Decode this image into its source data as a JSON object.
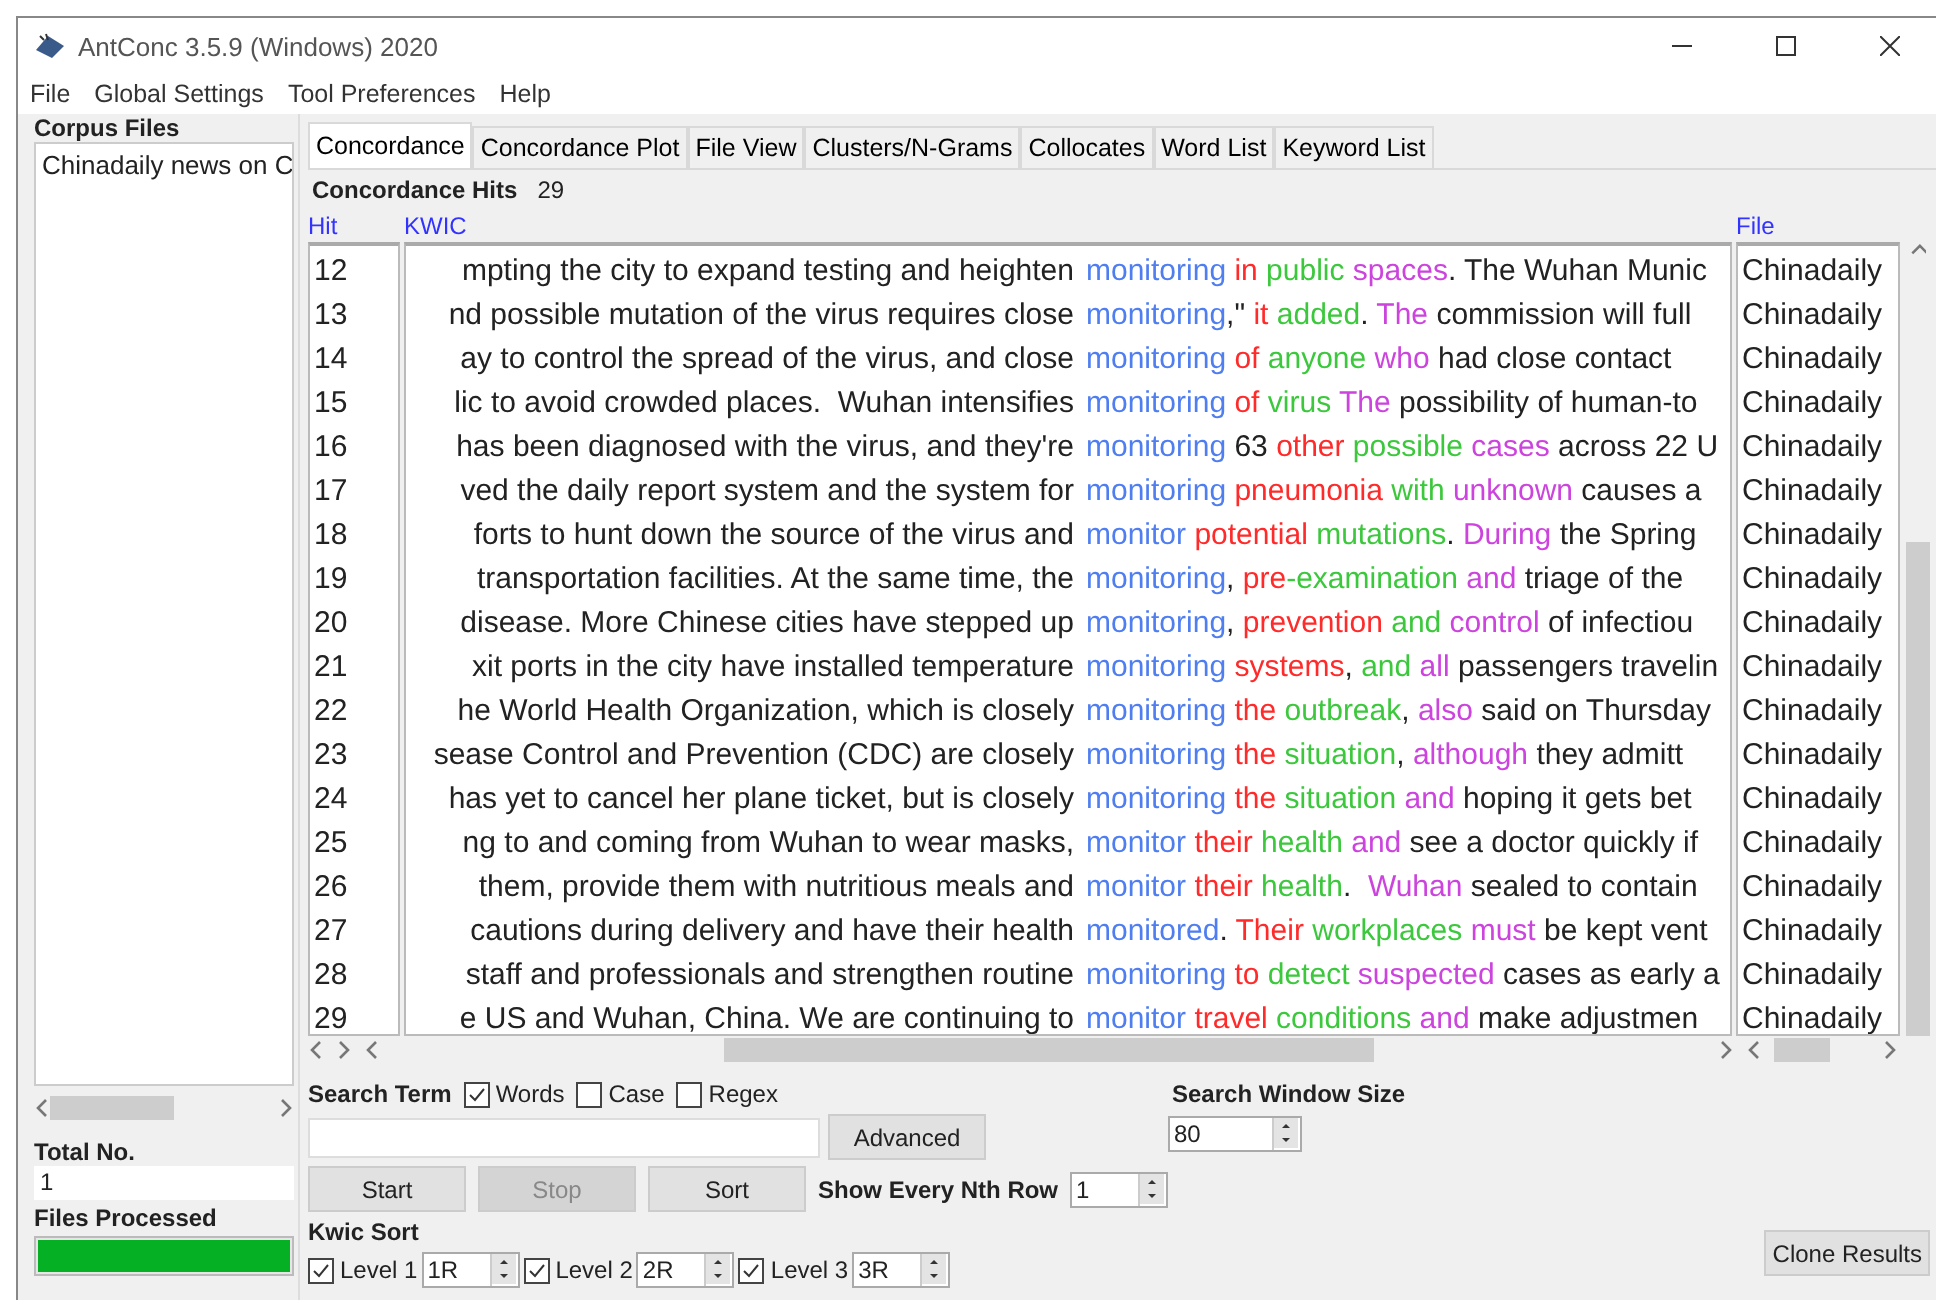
{
  "window": {
    "title": "AntConc 3.5.9 (Windows) 2020"
  },
  "menu": [
    "File",
    "Global Settings",
    "Tool Preferences",
    "Help"
  ],
  "sidebar": {
    "title": "Corpus Files",
    "files": [
      "Chinadaily news on C"
    ],
    "total_label": "Total No.",
    "total": "1",
    "processed_label": "Files Processed",
    "progress": {
      "level": 1
    }
  },
  "tabs": [
    {
      "label": "Concordance",
      "selected": true
    },
    {
      "label": "Concordance Plot",
      "selected": false
    },
    {
      "label": "File View",
      "selected": false
    },
    {
      "label": "Clusters/N-Grams",
      "selected": false
    },
    {
      "label": "Collocates",
      "selected": false
    },
    {
      "label": "Word List",
      "selected": false
    },
    {
      "label": "Keyword List",
      "selected": false
    }
  ],
  "hits": {
    "label": "Concordance Hits",
    "count": "29"
  },
  "columns": {
    "hit": "Hit",
    "kwic": "KWIC",
    "file": "File"
  },
  "rows": [
    {
      "hit": "12",
      "left": "mpting the city to expand testing and heighten",
      "right": [
        {
          "text": "monitoring",
          "kind": "hit"
        },
        {
          "text": " in",
          "color": "#ff2a2a"
        },
        {
          "text": " public",
          "color": "#3cc83c"
        },
        {
          "text": " spaces",
          "color": "#cc44dd"
        },
        {
          "text": ". The Wuhan Munic"
        }
      ],
      "file": "Chinadaily"
    },
    {
      "hit": "13",
      "left": "nd possible mutation of the virus requires close",
      "right": [
        {
          "text": "monitoring",
          "kind": "hit"
        },
        {
          "text": ",\""
        },
        {
          "text": " it",
          "color": "#ff2a2a"
        },
        {
          "text": " added",
          "color": "#3cc83c"
        },
        {
          "text": "."
        },
        {
          "text": " The",
          "color": "#cc44dd"
        },
        {
          "text": " commission will full"
        }
      ],
      "file": "Chinadaily"
    },
    {
      "hit": "14",
      "left": "ay to control the spread of the virus, and close",
      "right": [
        {
          "text": "monitoring",
          "kind": "hit"
        },
        {
          "text": " of",
          "color": "#ff2a2a"
        },
        {
          "text": " anyone",
          "color": "#3cc83c"
        },
        {
          "text": " who",
          "color": "#cc44dd"
        },
        {
          "text": " had close contact"
        }
      ],
      "file": "Chinadaily"
    },
    {
      "hit": "15",
      "left": "lic to avoid crowded places.  Wuhan intensifies",
      "right": [
        {
          "text": "monitoring",
          "kind": "hit"
        },
        {
          "text": " of",
          "color": "#ff2a2a"
        },
        {
          "text": " virus",
          "color": "#3cc83c"
        },
        {
          "text": " The",
          "color": "#cc44dd"
        },
        {
          "text": " possibility of human-to"
        }
      ],
      "file": "Chinadaily"
    },
    {
      "hit": "16",
      "left": "has been diagnosed with the virus, and they're",
      "right": [
        {
          "text": "monitoring",
          "kind": "hit"
        },
        {
          "text": " 63"
        },
        {
          "text": " other",
          "color": "#ff2a2a"
        },
        {
          "text": " possible",
          "color": "#3cc83c"
        },
        {
          "text": " cases",
          "color": "#cc44dd"
        },
        {
          "text": " across 22 U"
        }
      ],
      "file": "Chinadaily"
    },
    {
      "hit": "17",
      "left": "ved the daily report system and the system for",
      "right": [
        {
          "text": "monitoring",
          "kind": "hit"
        },
        {
          "text": " pneumonia",
          "color": "#ff2a2a"
        },
        {
          "text": " with",
          "color": "#3cc83c"
        },
        {
          "text": " unknown",
          "color": "#cc44dd"
        },
        {
          "text": " causes a"
        }
      ],
      "file": "Chinadaily"
    },
    {
      "hit": "18",
      "left": "forts to hunt down the source of the virus and",
      "right": [
        {
          "text": "monitor",
          "kind": "hit"
        },
        {
          "text": " potential",
          "color": "#ff2a2a"
        },
        {
          "text": " mutations",
          "color": "#3cc83c"
        },
        {
          "text": "."
        },
        {
          "text": " During",
          "color": "#cc44dd"
        },
        {
          "text": " the Spring"
        }
      ],
      "file": "Chinadaily"
    },
    {
      "hit": "19",
      "left": "transportation facilities. At the same time, the",
      "right": [
        {
          "text": "monitoring",
          "kind": "hit"
        },
        {
          "text": ","
        },
        {
          "text": " pre",
          "color": "#ff2a2a"
        },
        {
          "text": "-examination",
          "color": "#3cc83c"
        },
        {
          "text": " and",
          "color": "#cc44dd"
        },
        {
          "text": " triage of the"
        }
      ],
      "file": "Chinadaily"
    },
    {
      "hit": "20",
      "left": "disease. More Chinese cities have stepped up",
      "right": [
        {
          "text": "monitoring",
          "kind": "hit"
        },
        {
          "text": ","
        },
        {
          "text": " prevention",
          "color": "#ff2a2a"
        },
        {
          "text": " and",
          "color": "#3cc83c"
        },
        {
          "text": " control",
          "color": "#cc44dd"
        },
        {
          "text": " of infectiou"
        }
      ],
      "file": "Chinadaily"
    },
    {
      "hit": "21",
      "left": "xit ports in the city have installed temperature",
      "right": [
        {
          "text": "monitoring",
          "kind": "hit"
        },
        {
          "text": " systems",
          "color": "#ff2a2a"
        },
        {
          "text": ","
        },
        {
          "text": " and",
          "color": "#3cc83c"
        },
        {
          "text": " all",
          "color": "#cc44dd"
        },
        {
          "text": " passengers travelin"
        }
      ],
      "file": "Chinadaily"
    },
    {
      "hit": "22",
      "left": "he World Health Organization, which is closely",
      "right": [
        {
          "text": "monitoring",
          "kind": "hit"
        },
        {
          "text": " the",
          "color": "#ff2a2a"
        },
        {
          "text": " outbreak",
          "color": "#3cc83c"
        },
        {
          "text": ","
        },
        {
          "text": " also",
          "color": "#cc44dd"
        },
        {
          "text": " said on Thursday"
        }
      ],
      "file": "Chinadaily"
    },
    {
      "hit": "23",
      "left": "sease Control and Prevention (CDC) are closely",
      "right": [
        {
          "text": "monitoring",
          "kind": "hit"
        },
        {
          "text": " the",
          "color": "#ff2a2a"
        },
        {
          "text": " situation",
          "color": "#3cc83c"
        },
        {
          "text": ","
        },
        {
          "text": " although",
          "color": "#cc44dd"
        },
        {
          "text": " they admitt"
        }
      ],
      "file": "Chinadaily"
    },
    {
      "hit": "24",
      "left": "has yet to cancel her plane ticket, but is closely",
      "right": [
        {
          "text": "monitoring",
          "kind": "hit"
        },
        {
          "text": " the",
          "color": "#ff2a2a"
        },
        {
          "text": " situation",
          "color": "#3cc83c"
        },
        {
          "text": " and",
          "color": "#cc44dd"
        },
        {
          "text": " hoping it gets bet"
        }
      ],
      "file": "Chinadaily"
    },
    {
      "hit": "25",
      "left": "ng to and coming from Wuhan to wear masks,",
      "right": [
        {
          "text": "monitor",
          "kind": "hit"
        },
        {
          "text": " their",
          "color": "#ff2a2a"
        },
        {
          "text": " health",
          "color": "#3cc83c"
        },
        {
          "text": " and",
          "color": "#cc44dd"
        },
        {
          "text": " see a doctor quickly if"
        }
      ],
      "file": "Chinadaily"
    },
    {
      "hit": "26",
      "left": "them, provide them with nutritious meals and",
      "right": [
        {
          "text": "monitor",
          "kind": "hit"
        },
        {
          "text": " their",
          "color": "#ff2a2a"
        },
        {
          "text": " health",
          "color": "#3cc83c"
        },
        {
          "text": ". "
        },
        {
          "text": " Wuhan",
          "color": "#cc44dd"
        },
        {
          "text": " sealed to contain"
        }
      ],
      "file": "Chinadaily"
    },
    {
      "hit": "27",
      "left": "cautions during delivery and have their health",
      "right": [
        {
          "text": "monitored",
          "kind": "hit"
        },
        {
          "text": "."
        },
        {
          "text": " Their",
          "color": "#ff2a2a"
        },
        {
          "text": " workplaces",
          "color": "#3cc83c"
        },
        {
          "text": " must",
          "color": "#cc44dd"
        },
        {
          "text": " be kept vent"
        }
      ],
      "file": "Chinadaily"
    },
    {
      "hit": "28",
      "left": "staff and professionals and strengthen routine",
      "right": [
        {
          "text": "monitoring",
          "kind": "hit"
        },
        {
          "text": " to",
          "color": "#ff2a2a"
        },
        {
          "text": " detect",
          "color": "#3cc83c"
        },
        {
          "text": " suspected",
          "color": "#cc44dd"
        },
        {
          "text": " cases as early a"
        }
      ],
      "file": "Chinadaily"
    },
    {
      "hit": "29",
      "left": "e US and Wuhan, China. We are continuing to",
      "right": [
        {
          "text": "monitor",
          "kind": "hit"
        },
        {
          "text": " travel",
          "color": "#ff2a2a"
        },
        {
          "text": " conditions",
          "color": "#3cc83c"
        },
        {
          "text": " and",
          "color": "#cc44dd"
        },
        {
          "text": " make adjustmen"
        }
      ],
      "file": "Chinadaily"
    }
  ],
  "search": {
    "label": "Search Term",
    "options": [
      {
        "label": "Words",
        "checked": true
      },
      {
        "label": "Case",
        "checked": false
      },
      {
        "label": "Regex",
        "checked": false
      }
    ],
    "advanced": "Advanced",
    "window_label": "Search Window Size",
    "window_size": "80"
  },
  "actions": [
    {
      "label": "Start",
      "disabled": false
    },
    {
      "label": "Stop",
      "disabled": true
    },
    {
      "label": "Sort",
      "disabled": false
    }
  ],
  "nth": {
    "label": "Show Every Nth Row",
    "value": "1"
  },
  "kwic_sort": {
    "label": "Kwic Sort",
    "levels": [
      {
        "label": "Level 1",
        "checked": true,
        "value": "1R"
      },
      {
        "label": "Level 2",
        "checked": true,
        "value": "2R"
      },
      {
        "label": "Level 3",
        "checked": true,
        "value": "3R"
      }
    ]
  },
  "clone": "Clone Results"
}
